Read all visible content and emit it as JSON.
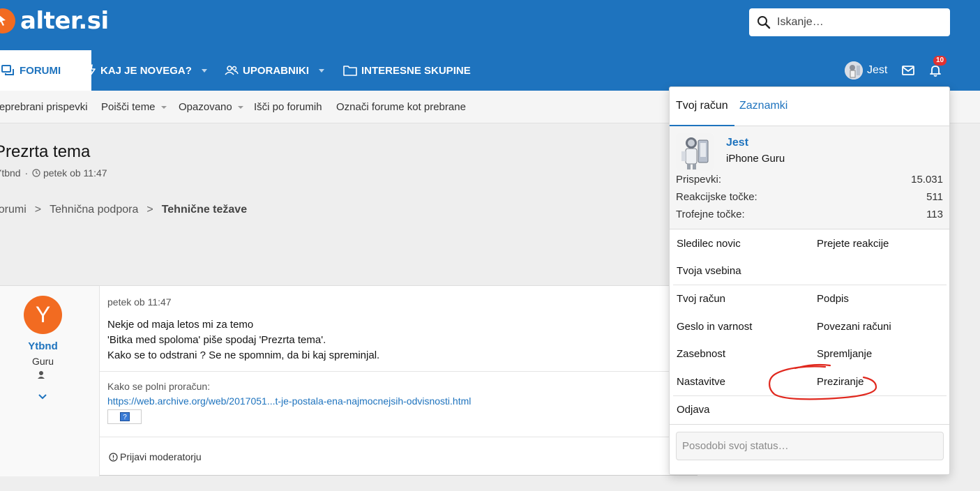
{
  "header": {
    "logo_text": "alter.si",
    "search_placeholder": "Iskanje…",
    "brand_color": "#1e73be",
    "accent_color": "#f26b21"
  },
  "nav": {
    "tabs": [
      {
        "label": "FORUMI",
        "icon": "forum-icon",
        "active": true
      },
      {
        "label": "KAJ JE NOVEGA?",
        "icon": "bolt-icon",
        "dropdown": true
      },
      {
        "label": "UPORABNIKI",
        "icon": "users-icon",
        "dropdown": true
      },
      {
        "label": "INTERESNE SKUPINE",
        "icon": "folder-icon"
      }
    ],
    "user_name": "Jest",
    "alerts_count": "10"
  },
  "subnav": {
    "items": [
      "Neprebrani prispevki",
      "Poišči teme",
      "Opazovano",
      "Išči po forumih",
      "Označi forume kot prebrane"
    ]
  },
  "page": {
    "title": "Prezrta tema",
    "author": "Ytbnd",
    "meta_sep": "·",
    "date": "petek ob 11:47",
    "breadcrumb": [
      "Forumi",
      "Tehnična podpora",
      "Tehnične težave"
    ]
  },
  "post": {
    "avatar_letter": "Y",
    "username": "Ytbnd",
    "user_title": "Guru",
    "date": "petek ob 11:47",
    "body_lines": [
      "Nekje od maja letos mi za temo",
      "'Bitka med spoloma' piše spodaj 'Prezrta tema'.",
      "Kako se to odstrani ? Se ne spomnim, da bi kaj spreminjal."
    ],
    "signature_label": "Kako se polni proračun:",
    "signature_link": "https://web.archive.org/web/2017051...t-je-postala-ena-najmocnejsih-odvisnosti.html",
    "broken_image_glyph": "?",
    "report_label": "Prijavi moderatorju"
  },
  "account_menu": {
    "tabs": [
      "Tvoj račun",
      "Zaznamki"
    ],
    "name": "Jest",
    "user_title": "iPhone Guru",
    "stats": [
      {
        "label": "Prispevki:",
        "value": "15.031"
      },
      {
        "label": "Reakcijske točke:",
        "value": "511"
      },
      {
        "label": "Trofejne točke:",
        "value": "113"
      }
    ],
    "links_group1": [
      "Sledilec novic",
      "Prejete reakcije",
      "Tvoja vsebina"
    ],
    "links_group2": [
      "Tvoj račun",
      "Podpis",
      "Geslo in varnost",
      "Povezani računi",
      "Zasebnost",
      "Spremljanje",
      "Nastavitve",
      "Preziranje"
    ],
    "logout": "Odjava",
    "status_placeholder": "Posodobi svoj status…",
    "annotation_color": "#e0281e"
  }
}
